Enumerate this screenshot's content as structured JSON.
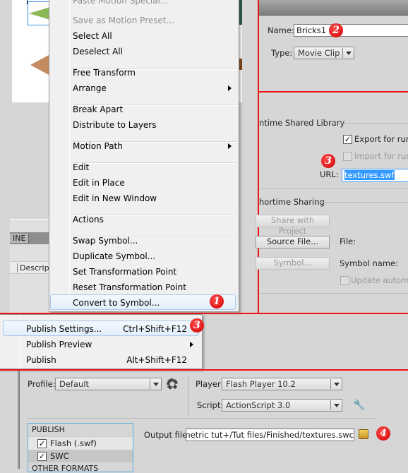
{
  "context_menu": {
    "items": [
      {
        "label": "Paste Motion Special...",
        "disabled": true
      },
      {
        "label": "Save as Motion Preset...",
        "disabled": true
      },
      {
        "label": "Select All"
      },
      {
        "label": "Deselect All"
      },
      {
        "label": "Free Transform"
      },
      {
        "label": "Arrange",
        "submenu": true
      },
      {
        "label": "Break Apart"
      },
      {
        "label": "Distribute to Layers"
      },
      {
        "label": "Motion Path",
        "submenu": true
      },
      {
        "label": "Edit"
      },
      {
        "label": "Edit in Place"
      },
      {
        "label": "Edit in New Window"
      },
      {
        "label": "Actions"
      },
      {
        "label": "Swap Symbol..."
      },
      {
        "label": "Duplicate Symbol..."
      },
      {
        "label": "Set Transformation Point"
      },
      {
        "label": "Reset Transformation Point"
      },
      {
        "label": "Convert to Symbol...",
        "highlighted": true
      }
    ]
  },
  "panel_left": {
    "tab_label": "INE",
    "column_label": "Descrip"
  },
  "badges": {
    "step1": "1",
    "step2": "2",
    "step3a": "3",
    "step3b": "3",
    "step4": "4"
  },
  "symbol_dialog": {
    "name_label": "Name:",
    "name_value": "Bricks1",
    "type_label": "Type:",
    "type_value": "Movie Clip"
  },
  "runtime_library": {
    "section_title": "ntime Shared Library",
    "export_label": "Export for runti",
    "export_checked": true,
    "import_label": "Import for runt",
    "import_checked": false,
    "url_label": "URL:",
    "url_value": "textures.swf"
  },
  "authortime_sharing": {
    "section_title": "hortime Sharing",
    "share_button": "Share with Project",
    "source_button": "Source File...",
    "symbol_button": "Symbol...",
    "file_label": "File:",
    "symbol_name_label": "Symbol name:",
    "update_label": "Update automat"
  },
  "publish_menu": {
    "items": [
      {
        "label": "Publish Settings...",
        "shortcut": "Ctrl+Shift+F12",
        "highlighted": true
      },
      {
        "label": "Publish Preview",
        "shortcut": "",
        "submenu": true
      },
      {
        "label": "Publish",
        "shortcut": "Alt+Shift+F12"
      }
    ]
  },
  "publish_settings": {
    "profile_label": "Profile:",
    "profile_value": "Default",
    "player_label": "Player:",
    "player_value": "Flash Player 10.2",
    "script_label": "Script:",
    "script_value": "ActionScript 3.0",
    "list_header": "PUBLISH",
    "formats": [
      {
        "label": "Flash (.swf)",
        "checked": true
      },
      {
        "label": "SWC",
        "checked": true
      }
    ],
    "other_header": "OTHER FORMATS",
    "output_label": "Output file:",
    "output_value": "op/Isometric tut+/Tut files/Finished/textures.swc"
  },
  "colors": {
    "annotation_red": "#ee1111",
    "selection_blue": "#3399ff"
  }
}
